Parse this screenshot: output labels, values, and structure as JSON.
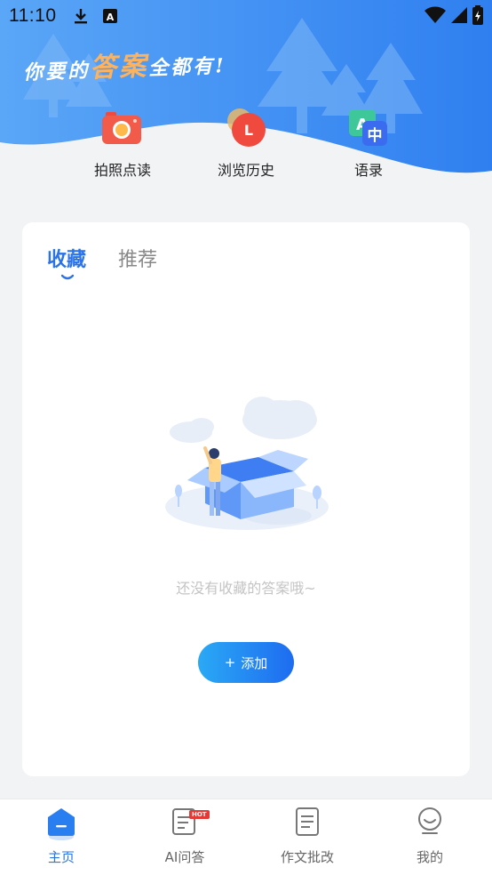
{
  "status_bar": {
    "time": "11:10",
    "a_indicator": "A"
  },
  "header": {
    "slogan_part1": "你要的",
    "slogan_highlight": "答案",
    "slogan_part2": "全都有!",
    "quick_actions": [
      {
        "label": "拍照点读",
        "icon": "camera-icon",
        "badge": ""
      },
      {
        "label": "浏览历史",
        "icon": "history-icon",
        "badge": "L"
      },
      {
        "label": "语录",
        "icon": "translate-icon",
        "badge": "中"
      }
    ]
  },
  "content": {
    "tabs": [
      {
        "label": "收藏",
        "active": true
      },
      {
        "label": "推荐",
        "active": false
      }
    ],
    "empty_message": "还没有收藏的答案哦~",
    "add_button": {
      "icon": "+",
      "label": "添加"
    }
  },
  "bottom_nav": [
    {
      "label": "主页",
      "icon": "home-icon",
      "active": true
    },
    {
      "label": "AI问答",
      "icon": "ai-qa-icon",
      "active": false,
      "badge": "HOT"
    },
    {
      "label": "作文批改",
      "icon": "essay-icon",
      "active": false
    },
    {
      "label": "我的",
      "icon": "profile-icon",
      "active": false
    }
  ],
  "colors": {
    "header_blue": "#3d8ef0",
    "accent": "#2a73e8",
    "slogan_highlight": "#ffb25c",
    "hot_badge": "#e53935"
  }
}
